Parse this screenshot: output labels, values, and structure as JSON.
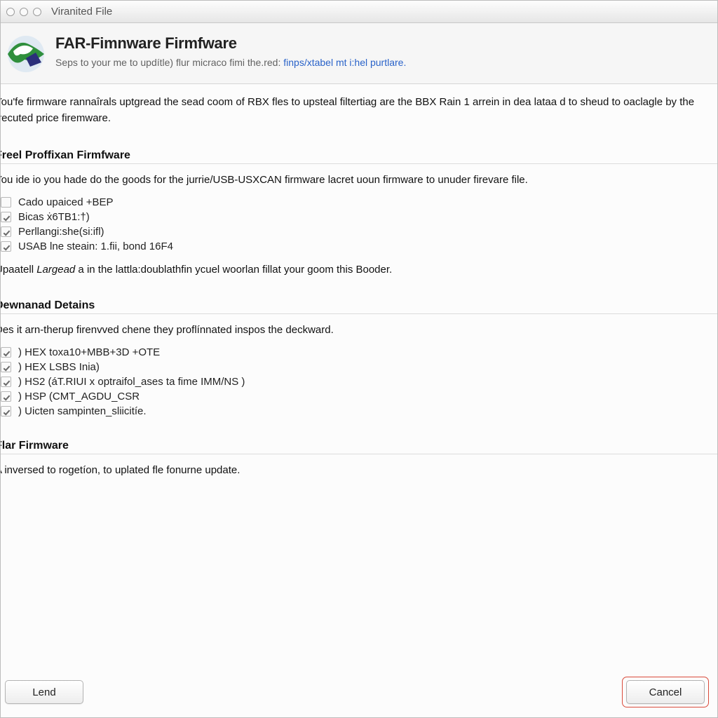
{
  "window": {
    "title": "Viranited File"
  },
  "header": {
    "title": "FAR-Fimnware Firmfware",
    "subtitle_prefix": "Seps to your me to updítle) flur micraco fimi the.red: ",
    "subtitle_link": "finps/xtabel mt i:hel purtlare."
  },
  "intro": "You'fe firmware rannaîrals uptgread the sead coom of RBX fles to upsteal filtertiag are the BBX Rain 1 arrein in dea lataa d to sheud to oaclagle by the frecuted price firemware.",
  "section1": {
    "title": "Freel Proffixan Firmfware",
    "body": "You ide io you hade do the goods for the jurrie/USB-USXCAN firmware lacret uoun firmware to unuder firevare file.",
    "items": [
      {
        "label": "Cado upaiced +BEP",
        "checked": false
      },
      {
        "label": "Bicas ẋ6TB1:†)",
        "checked": true
      },
      {
        "label": "Perllangi:she(si:ifl)",
        "checked": true
      },
      {
        "label": "USAB lne steain: 1.fii, bond 16F4",
        "checked": true
      }
    ],
    "after": "Upaatell Largead a in the lattla:doublathfin ycuel woorlan fillat your goom this Booder."
  },
  "section2": {
    "title": "Dewnanad Detains",
    "body": "Des it arn-therup firenvved chene they proflínnated inspos the deckward.",
    "items": [
      {
        "label": ") HEX toxa10+MBB+3D +OTE",
        "checked": true
      },
      {
        "label": ") HEX LSBS Inia)",
        "checked": true
      },
      {
        "label": ") HS2 (áT.RIUI x optraifol_ases ta fime IMM/NS )",
        "checked": true
      },
      {
        "label": ") HSP (CMT_AGDU_CSR",
        "checked": true
      },
      {
        "label": ") Uicten sampinten_sliicitíe.",
        "checked": true
      }
    ]
  },
  "section3": {
    "title": "Flar Firmware",
    "body": "A inversed to rogetíon, to uplated fle fonurne update."
  },
  "footer": {
    "left_button": "Lend",
    "right_button": "Cancel"
  }
}
